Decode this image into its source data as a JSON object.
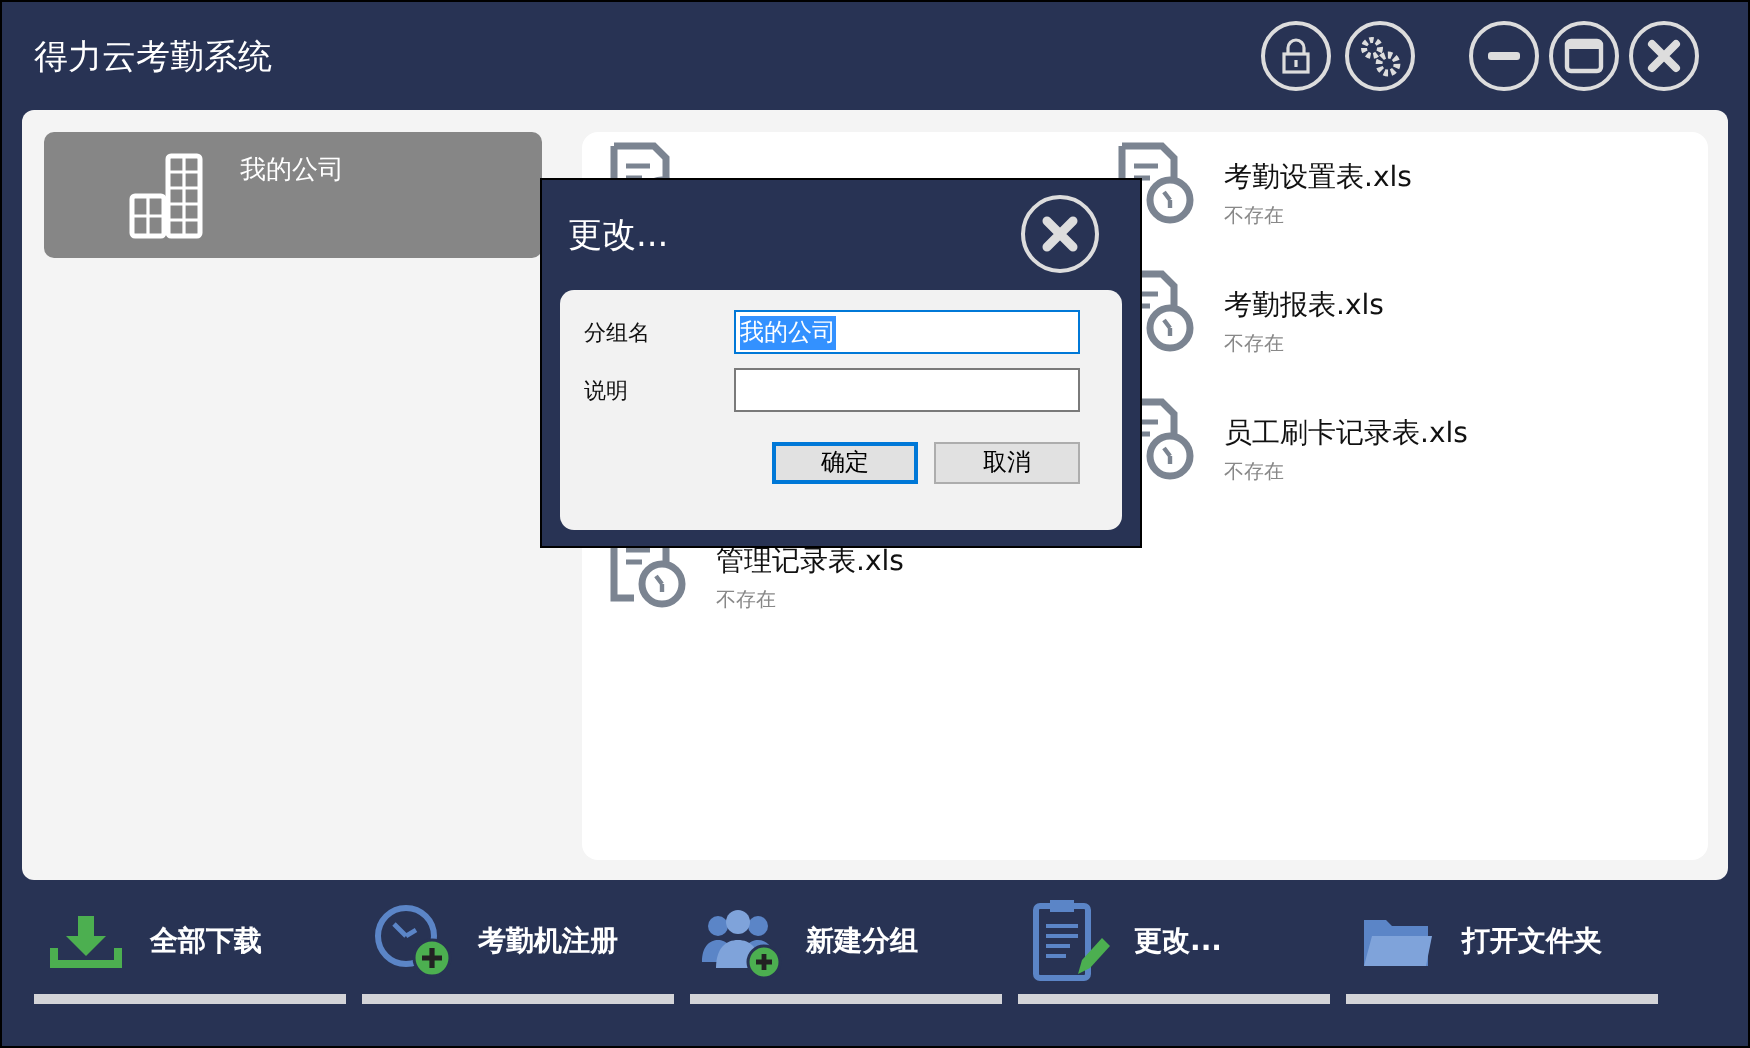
{
  "window": {
    "title": "得力云考勤系统"
  },
  "groups": [
    {
      "name": "我的公司",
      "selected": true
    }
  ],
  "files": [
    {
      "name": "考勤设置表.xls",
      "status": "不存在"
    },
    {
      "name": "考勤报表.xls",
      "status": "不存在"
    },
    {
      "name": "员工刷卡记录表.xls",
      "status": "不存在"
    },
    {
      "name": "管理记录表.xls",
      "status": "不存在"
    }
  ],
  "dialog": {
    "title": "更改...",
    "fields": [
      {
        "label": "分组名",
        "value": "我的公司",
        "text_selected": true
      },
      {
        "label": "说明"
      }
    ],
    "buttons": [
      {
        "label": "确定",
        "default": true
      },
      {
        "label": "取消",
        "default": false
      }
    ]
  },
  "toolbar": [
    {
      "label": "全部下载"
    },
    {
      "label": "考勤机注册"
    },
    {
      "label": "新建分组"
    },
    {
      "label": "更改..."
    },
    {
      "label": "打开文件夹"
    }
  ]
}
